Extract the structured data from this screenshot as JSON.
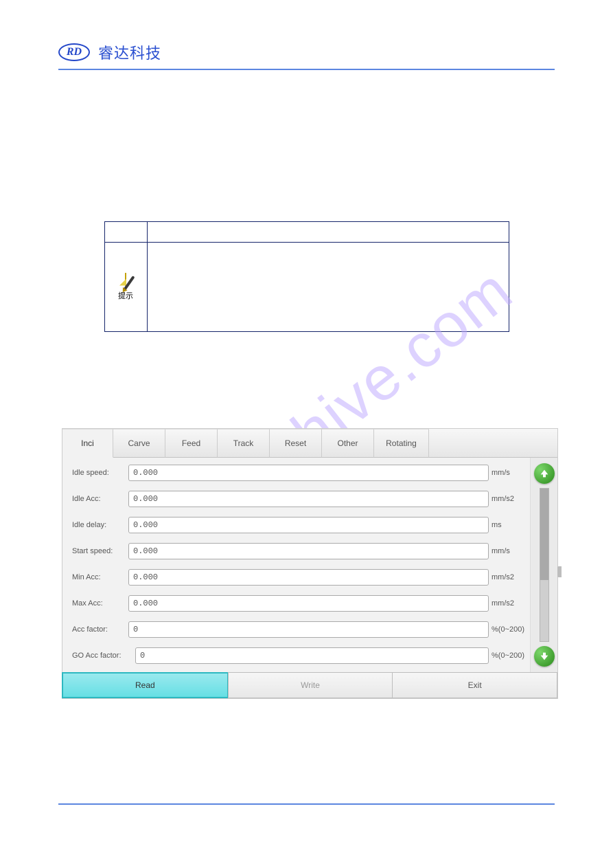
{
  "header": {
    "logo_text": "RD",
    "brand": "睿达科技"
  },
  "note": {
    "icon_label": "提示"
  },
  "watermark": "manualshive.com",
  "app": {
    "tabs": [
      {
        "label": "Inci"
      },
      {
        "label": "Carve"
      },
      {
        "label": "Feed"
      },
      {
        "label": "Track"
      },
      {
        "label": "Reset"
      },
      {
        "label": "Other"
      },
      {
        "label": "Rotating"
      }
    ],
    "fields": [
      {
        "label": "Idle speed:",
        "value": "0.000",
        "unit": "mm/s"
      },
      {
        "label": "Idle Acc:",
        "value": "0.000",
        "unit": "mm/s2"
      },
      {
        "label": "Idle delay:",
        "value": "0.000",
        "unit": "ms"
      },
      {
        "label": "Start speed:",
        "value": "0.000",
        "unit": "mm/s"
      },
      {
        "label": "Min Acc:",
        "value": "0.000",
        "unit": "mm/s2"
      },
      {
        "label": "Max Acc:",
        "value": "0.000",
        "unit": "mm/s2"
      },
      {
        "label": "Acc factor:",
        "value": "0",
        "unit": "%(0~200)"
      },
      {
        "label": "GO Acc factor:",
        "value": "0",
        "unit": "%(0~200)"
      }
    ],
    "buttons": {
      "read": "Read",
      "write": "Write",
      "exit": "Exit"
    }
  }
}
